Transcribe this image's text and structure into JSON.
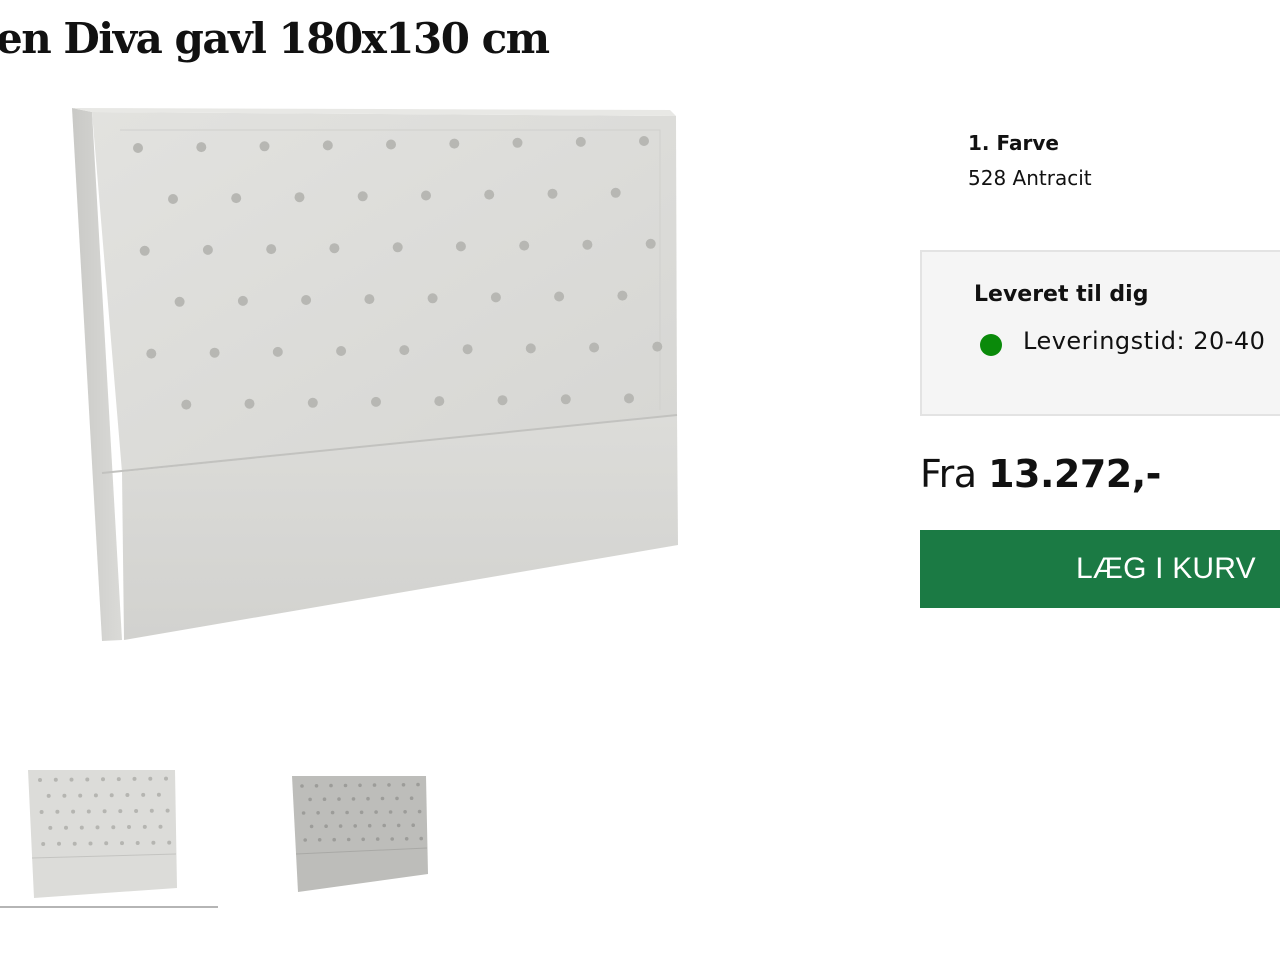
{
  "product": {
    "title": "en Diva gavl 180x130 cm",
    "main_image_alt": "tufted-headboard"
  },
  "gallery": {
    "thumbnails": [
      {
        "label": "light-grey-headboard",
        "color": "#dcdcd9",
        "selected": true
      },
      {
        "label": "grey-headboard",
        "color": "#b9b9b6",
        "selected": false
      }
    ]
  },
  "options": {
    "color_label": "1. Farve",
    "color_value": "528 Antracit"
  },
  "delivery": {
    "title": "Leveret til dig",
    "text": "Leveringstid: 20-40",
    "status_color": "#0a8a0a"
  },
  "pricing": {
    "prefix": "Fra",
    "amount": "13.272,-"
  },
  "actions": {
    "add_to_cart_label": "LÆG I KURV",
    "button_color": "#1b7a44"
  }
}
